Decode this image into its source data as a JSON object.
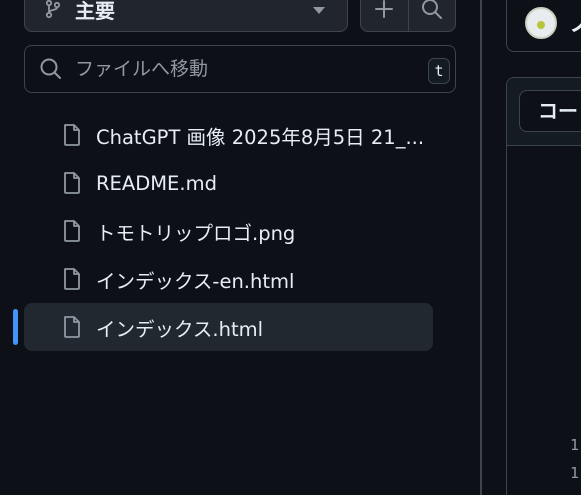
{
  "branch": {
    "label": "主要"
  },
  "search": {
    "placeholder": "ファイルへ移動",
    "shortcut": "t"
  },
  "files": [
    {
      "name": "ChatGPT 画像 2025年8月5日 21_...",
      "active": false
    },
    {
      "name": "README.md",
      "active": false
    },
    {
      "name": "トモトリップロゴ.png",
      "active": false
    },
    {
      "name": "インデックス-en.html",
      "active": false
    },
    {
      "name": "インデックス.html",
      "active": true
    }
  ],
  "repo": {
    "title": "ノ"
  },
  "code": {
    "tab_label": "コー"
  },
  "line_numbers": [
    "1",
    "1"
  ],
  "colors": {
    "accent": "#4493f8",
    "background": "#0d1117",
    "border": "#3d444d"
  },
  "icons": {
    "branch": "git-branch-icon",
    "add": "plus-icon",
    "search": "search-icon",
    "file": "file-icon",
    "caret": "chevron-down-icon"
  }
}
